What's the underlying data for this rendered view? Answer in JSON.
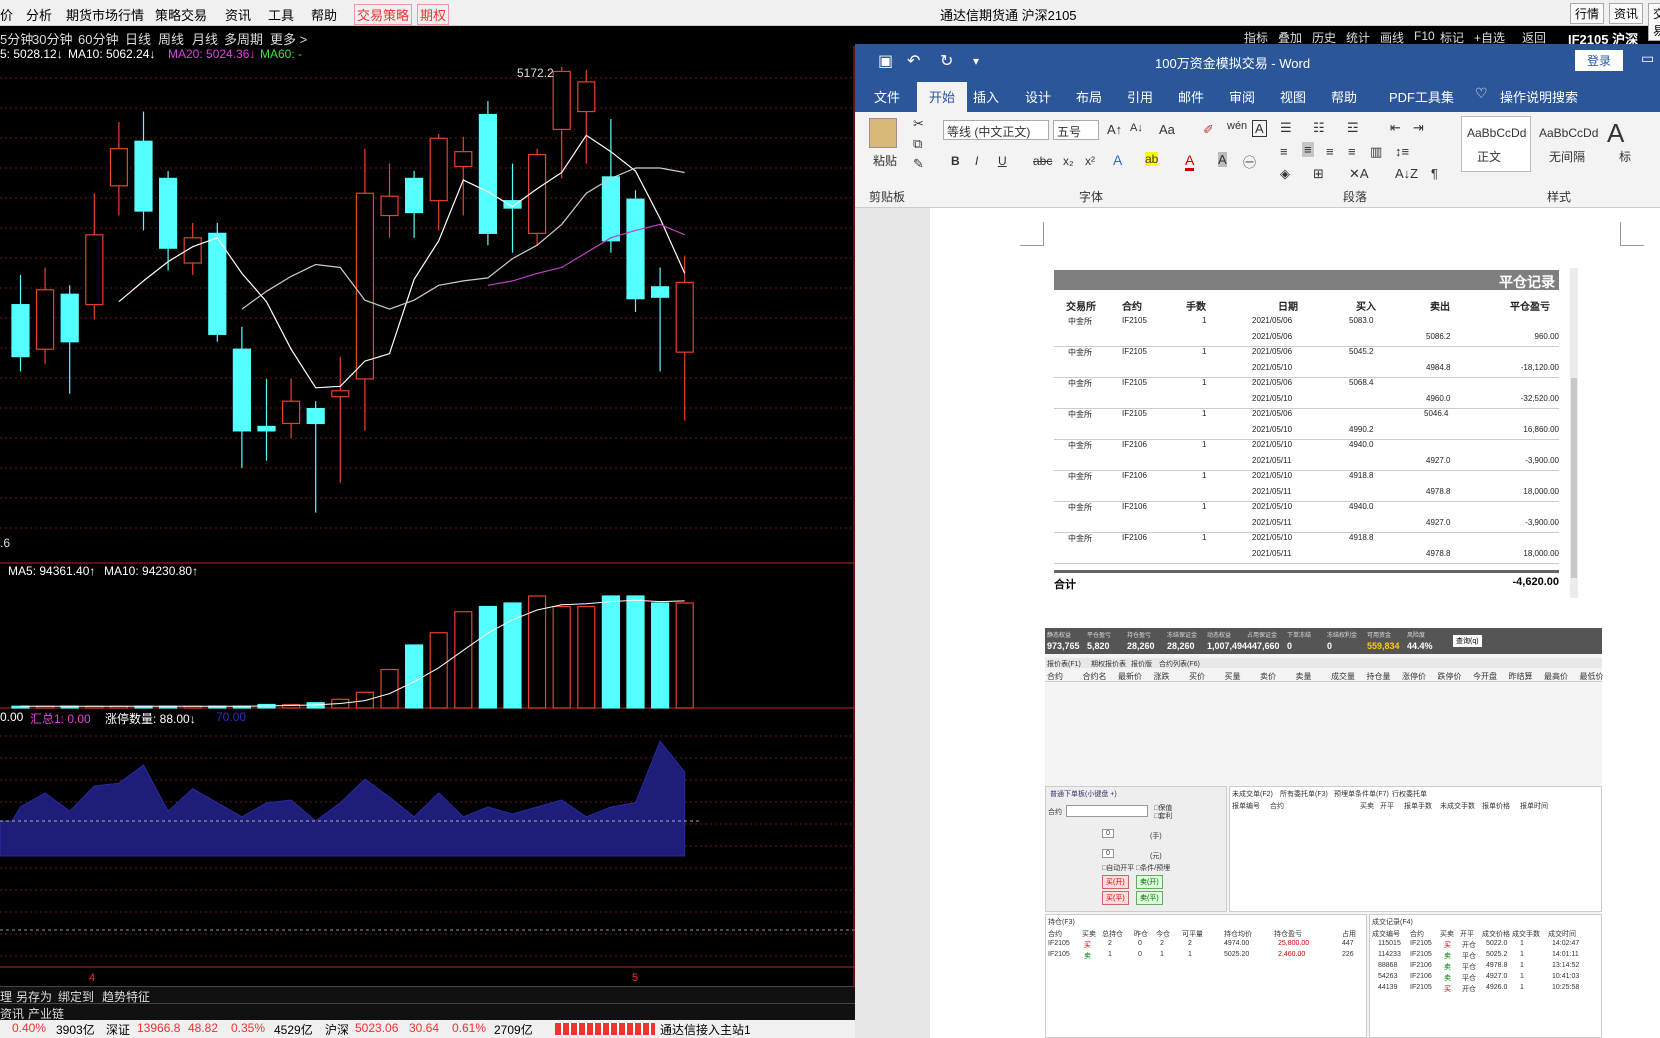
{
  "top_menu": {
    "items": [
      "价",
      "分析",
      "期货市场行情",
      "策略交易",
      "资讯",
      "工具",
      "帮助"
    ],
    "highlight_items": [
      "交易策略",
      "期权"
    ],
    "title": "通达信期货通  沪深2105",
    "right_buttons": [
      "行情",
      "资讯",
      "交易"
    ]
  },
  "period_bar": [
    "5分钟",
    "30分钟",
    "60分钟",
    "日线",
    "周线",
    "月线",
    "多周期",
    "更多 >"
  ],
  "ma_legend": {
    "ma5": "5: 5028.12↓",
    "ma10": "MA10: 5062.24↓",
    "ma20": "MA20: 5024.36↓",
    "ma60": "MA60: -"
  },
  "right_toolbar": [
    "指标",
    "叠加",
    "历史",
    "统计",
    "画线",
    "F10",
    "标记",
    "+自选",
    "返回"
  ],
  "symbol_tag": "IF2105 沪深",
  "high_label": "5172.2",
  "low_label": ".6",
  "vol_legend": {
    "ma5": "MA5: 94361.40↑",
    "ma10": "MA10: 94230.80↑"
  },
  "ind_legend": {
    "a": "0.00",
    "b": "汇总1: 0.00",
    "c": "涨停数量: 88.00↓",
    "d": "70.00"
  },
  "date_labels": [
    "4",
    "5"
  ],
  "bottom_bar1": [
    "理",
    "另存为",
    "绑定到",
    "趋势特征"
  ],
  "bottom_bar2": [
    "资讯",
    "产业链"
  ],
  "status": {
    "a": "0.40%",
    "b": "3903亿",
    "c": "深证",
    "d": "13966.8",
    "e": "48.82",
    "f": "0.35%",
    "g": "4529亿",
    "h": "沪深",
    "i": "5023.06",
    "j": "30.64",
    "k": "0.61%",
    "l": "2709亿",
    "m": "通达信接入主站1"
  },
  "chart_data": {
    "type": "candlestick",
    "candles": [
      {
        "o": 5035,
        "c": 5000,
        "h": 5055,
        "l": 4990
      },
      {
        "o": 5005,
        "c": 5045,
        "h": 5060,
        "l": 4995
      },
      {
        "o": 5042,
        "c": 5010,
        "h": 5048,
        "l": 4975
      },
      {
        "o": 5035,
        "c": 5082,
        "h": 5110,
        "l": 5025
      },
      {
        "o": 5115,
        "c": 5140,
        "h": 5158,
        "l": 5095
      },
      {
        "o": 5145,
        "c": 5098,
        "h": 5165,
        "l": 5085
      },
      {
        "o": 5120,
        "c": 5073,
        "h": 5125,
        "l": 5058
      },
      {
        "o": 5063,
        "c": 5080,
        "h": 5090,
        "l": 5055
      },
      {
        "o": 5083,
        "c": 5015,
        "h": 5090,
        "l": 5010
      },
      {
        "o": 5005,
        "c": 4950,
        "h": 5020,
        "l": 4925
      },
      {
        "o": 4953,
        "c": 4950,
        "h": 4985,
        "l": 4930
      },
      {
        "o": 4955,
        "c": 4970,
        "h": 4985,
        "l": 4945
      },
      {
        "o": 4965,
        "c": 4955,
        "h": 4970,
        "l": 4895
      },
      {
        "o": 4973,
        "c": 4977,
        "h": 5000,
        "l": 4915
      },
      {
        "o": 4985,
        "c": 5110,
        "h": 5140,
        "l": 4950
      },
      {
        "o": 5095,
        "c": 5108,
        "h": 5130,
        "l": 5080
      },
      {
        "o": 5120,
        "c": 5097,
        "h": 5125,
        "l": 5080
      },
      {
        "o": 5105,
        "c": 5147,
        "h": 5150,
        "l": 5085
      },
      {
        "o": 5128,
        "c": 5138,
        "h": 5148,
        "l": 5095
      },
      {
        "o": 5163,
        "c": 5083,
        "h": 5172,
        "l": 5075
      },
      {
        "o": 5105,
        "c": 5100,
        "h": 5130,
        "l": 5070
      },
      {
        "o": 5083,
        "c": 5136,
        "h": 5140,
        "l": 5075
      },
      {
        "o": 5153,
        "c": 5192,
        "h": 5195,
        "l": 5120
      },
      {
        "o": 5165,
        "c": 5185,
        "h": 5193,
        "l": 5130
      },
      {
        "o": 5121,
        "c": 5078,
        "h": 5160,
        "l": 5070
      },
      {
        "o": 5106,
        "c": 5039,
        "h": 5112,
        "l": 5030
      },
      {
        "o": 5047,
        "c": 5040,
        "h": 5060,
        "l": 4990
      },
      {
        "o": 5003,
        "c": 5050,
        "h": 5068,
        "l": 4957
      }
    ],
    "ma5": [
      null,
      null,
      null,
      null,
      5037,
      5051,
      5064,
      5074,
      5080,
      5056,
      5037,
      5005,
      4979,
      4980,
      4997,
      5002,
      5052,
      5078,
      5119,
      5111,
      5101,
      5113,
      5124,
      5149,
      5138,
      5125,
      5093,
      5056
    ],
    "ma10": [
      null,
      null,
      null,
      null,
      null,
      null,
      null,
      null,
      null,
      5032,
      5044,
      5054,
      5062,
      5060,
      5038,
      5032,
      5038,
      5048,
      5051,
      5053,
      5066,
      5075,
      5089,
      5110,
      5120,
      5127,
      5127,
      5124
    ],
    "ma20": [
      null,
      null,
      null,
      null,
      null,
      null,
      null,
      null,
      null,
      null,
      null,
      null,
      null,
      null,
      null,
      null,
      null,
      null,
      null,
      5048,
      5051,
      5056,
      5060,
      5070,
      5080,
      5085,
      5089,
      5082
    ],
    "volume": [
      1,
      1,
      1,
      1,
      1,
      1,
      1,
      1,
      1,
      1,
      2,
      2,
      3,
      5,
      9,
      22,
      36,
      43,
      55,
      58,
      60,
      64,
      58,
      58,
      64,
      64,
      60,
      60
    ],
    "indicator": [
      45,
      55,
      42,
      60,
      62,
      75,
      42,
      58,
      48,
      38,
      48,
      50,
      35,
      48,
      65,
      52,
      38,
      55,
      38,
      45,
      40,
      45,
      50,
      38,
      45,
      48,
      92,
      70
    ]
  },
  "word": {
    "title": "100万资金模拟交易  -  Word",
    "login": "登录",
    "tabs": [
      "文件",
      "开始",
      "插入",
      "设计",
      "布局",
      "引用",
      "邮件",
      "审阅",
      "视图",
      "帮助",
      "PDF工具集",
      "操作说明搜索"
    ],
    "active_tab": "开始",
    "ribbon": {
      "paste": "粘贴",
      "clipboard": "剪贴板",
      "font_name": "等线 (中文正文)",
      "font_size": "五号",
      "font_group": "字体",
      "para_group": "段落",
      "style_group": "样式",
      "style1": "AaBbCcDd",
      "style1_name": "正文",
      "style2": "AaBbCcDd",
      "style2_name": "无间隔",
      "style3": "A",
      "style3_name": "标"
    },
    "table": {
      "banner": "平仓记录",
      "headers": [
        "交易所",
        "合约",
        "手数",
        "日期",
        "买入",
        "卖出",
        "平仓盈亏"
      ],
      "rows": [
        {
          "ex": "中金所",
          "ct": "IF2105",
          "n": "1",
          "d1": "2021/05/06",
          "b1": "5083.0",
          "s1": "",
          "d2": "2021/05/06",
          "b2": "",
          "s2": "5086.2",
          "pl": "960.00"
        },
        {
          "ex": "中金所",
          "ct": "IF2105",
          "n": "1",
          "d1": "2021/05/06",
          "b1": "5045.2",
          "s1": "",
          "d2": "2021/05/10",
          "b2": "",
          "s2": "4984.8",
          "pl": "-18,120.00"
        },
        {
          "ex": "中金所",
          "ct": "IF2105",
          "n": "1",
          "d1": "2021/05/06",
          "b1": "5068.4",
          "s1": "",
          "d2": "2021/05/10",
          "b2": "",
          "s2": "4960.0",
          "pl": "-32,520.00"
        },
        {
          "ex": "中金所",
          "ct": "IF2105",
          "n": "1",
          "d1": "2021/05/06",
          "b1": "",
          "s1": "5046.4",
          "d2": "2021/05/10",
          "b2": "4990.2",
          "s2": "",
          "pl": "16,860.00"
        },
        {
          "ex": "中金所",
          "ct": "IF2106",
          "n": "1",
          "d1": "2021/05/10",
          "b1": "4940.0",
          "s1": "",
          "d2": "2021/05/11",
          "b2": "",
          "s2": "4927.0",
          "pl": "-3,900.00"
        },
        {
          "ex": "中金所",
          "ct": "IF2106",
          "n": "1",
          "d1": "2021/05/10",
          "b1": "4918.8",
          "s1": "",
          "d2": "2021/05/11",
          "b2": "",
          "s2": "4978.8",
          "pl": "18,000.00"
        },
        {
          "ex": "中金所",
          "ct": "IF2106",
          "n": "1",
          "d1": "2021/05/10",
          "b1": "4940.0",
          "s1": "",
          "d2": "2021/05/11",
          "b2": "",
          "s2": "4927.0",
          "pl": "-3,900.00"
        },
        {
          "ex": "中金所",
          "ct": "IF2106",
          "n": "1",
          "d1": "2021/05/10",
          "b1": "4918.8",
          "s1": "",
          "d2": "2021/05/11",
          "b2": "",
          "s2": "4978.8",
          "pl": "18,000.00"
        }
      ],
      "total_label": "合计",
      "total_value": "-4,620.00"
    },
    "acct": {
      "labels": [
        "静态权益",
        "平仓盈亏",
        "持仓盈亏",
        "冻结保证金",
        "动态权益",
        "占用保证金",
        "下单冻结",
        "冻结权利金",
        "可用资金",
        "风险度"
      ],
      "values": [
        "973,765",
        "5,820",
        "28,260",
        "28,260",
        "1,007,494",
        "447,660",
        "0",
        "0",
        "559,834",
        "44.4%"
      ],
      "query": "查询(q)"
    },
    "quote_tabs": [
      "报价表(F1)",
      "期权报价表",
      "报价版",
      "合约列表(F6)"
    ],
    "quote_headers": [
      "合约",
      "合约名",
      "最新价",
      "涨跌",
      "买价",
      "买量",
      "卖价",
      "卖量",
      "成交量",
      "持仓量",
      "涨停价",
      "跌停价",
      "今开盘",
      "昨结算",
      "最高价",
      "最低价"
    ],
    "order_tabs": [
      "普通下单板(小键盘 +)"
    ],
    "order_labels": [
      "合约",
      "保值",
      "套利",
      "0",
      "(手)",
      "0",
      "(元)",
      "自动开平",
      "条件/预埋",
      "买(开)",
      "卖(开)",
      "买(平)",
      "卖(平)"
    ],
    "pending_tabs": [
      "未成交单(F2)",
      "所有委托单(F3)",
      "预埋单条件单(F7)",
      "行权委托单"
    ],
    "pending_headers": [
      "报单编号",
      "合约",
      "买卖",
      "开平",
      "报单手数",
      "未成交手数",
      "报单价格",
      "报单时间"
    ],
    "pos_tab": "持仓(F3)",
    "pos_headers": [
      "合约",
      "买卖",
      "总持仓",
      "昨仓",
      "今仓",
      "可平量",
      "持仓均价",
      "持仓盈亏",
      "占用"
    ],
    "positions": [
      {
        "ct": "IF2105",
        "bs": "买",
        "tot": "2",
        "y": "0",
        "t": "2",
        "av": "2",
        "avg": "4974.00",
        "pl": "25,800.00",
        "m": "447"
      },
      {
        "ct": "IF2105",
        "bs": "卖",
        "tot": "1",
        "y": "0",
        "t": "1",
        "av": "1",
        "avg": "5025.20",
        "pl": "2,460.00",
        "m": "226"
      }
    ],
    "deal_tab": "成交记录(F4)",
    "deal_headers": [
      "成交编号",
      "合约",
      "买卖",
      "开平",
      "成交价格",
      "成交手数",
      "成交时间"
    ],
    "deals": [
      {
        "id": "115015",
        "ct": "IF2105",
        "bs": "买",
        "oc": "开仓",
        "p": "5022.0",
        "n": "1",
        "t": "14:02:47"
      },
      {
        "id": "114233",
        "ct": "IF2105",
        "bs": "卖",
        "oc": "平仓",
        "p": "5025.2",
        "n": "1",
        "t": "14:01:11"
      },
      {
        "id": "88868",
        "ct": "IF2106",
        "bs": "卖",
        "oc": "平仓",
        "p": "4978.8",
        "n": "1",
        "t": "13:14:52"
      },
      {
        "id": "54263",
        "ct": "IF2106",
        "bs": "卖",
        "oc": "平仓",
        "p": "4927.0",
        "n": "1",
        "t": "10:41:03"
      },
      {
        "id": "44139",
        "ct": "IF2105",
        "bs": "买",
        "oc": "开仓",
        "p": "4926.0",
        "n": "1",
        "t": "10:25:58"
      }
    ]
  }
}
